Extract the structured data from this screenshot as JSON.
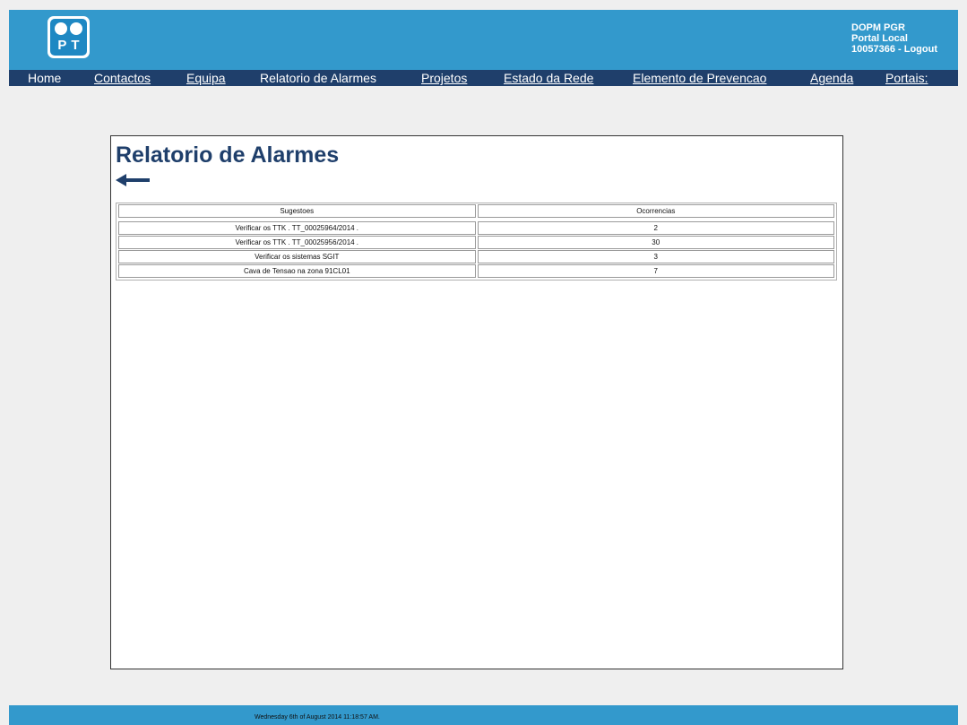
{
  "header": {
    "logo_text": "PT",
    "user": {
      "line1": "DOPM PGR",
      "line2": "Portal Local",
      "user_id": "10057366",
      "separator": " - ",
      "logout_label": "Logout"
    }
  },
  "nav": {
    "home": "Home",
    "contactos": "Contactos",
    "equipa": "Equipa",
    "relatorio": "Relatorio de Alarmes",
    "projetos": "Projetos",
    "estado": "Estado da Rede",
    "elemento": "Elemento de Prevencao",
    "agenda": "Agenda",
    "portais": "Portais:"
  },
  "main": {
    "title": "Relatorio de Alarmes",
    "back_icon": "arrow-left-icon",
    "table": {
      "headers": [
        "Sugestoes",
        "Ocorrencias"
      ],
      "rows": [
        [
          "Verificar os TTK . TT_00025964/2014 .",
          "2"
        ],
        [
          "Verificar os TTK . TT_00025956/2014 .",
          "30"
        ],
        [
          "Verificar os sistemas SGIT",
          "3"
        ],
        [
          "Cava de Tensao na zona 91CL01",
          "7"
        ]
      ]
    }
  },
  "footer": {
    "datetime": "Wednesday 6th of August 2014 11:18:57 AM."
  },
  "colors": {
    "header_bg": "#3399cc",
    "nav_bg": "#1f3f6b",
    "title": "#1f3f6b",
    "page_bg": "#efefef"
  }
}
